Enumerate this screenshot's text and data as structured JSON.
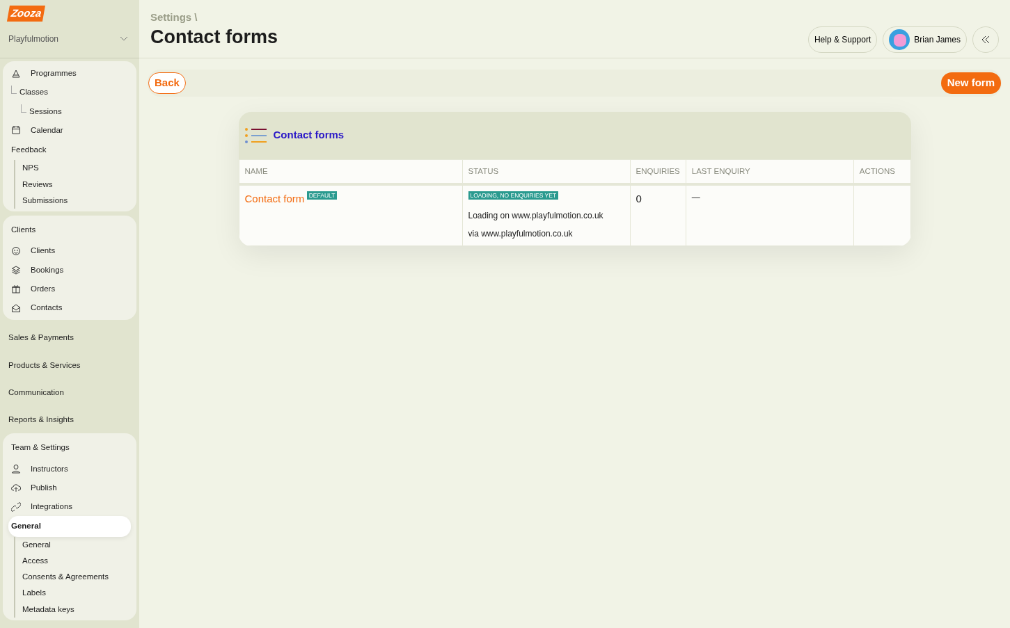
{
  "sidebar": {
    "logo": "Zooza",
    "org": "Playfulmotion",
    "sections": [
      {
        "panel": true,
        "items": [
          {
            "kind": "tree",
            "label": "Programmes",
            "selected": false,
            "children": [
              {
                "label": "Classes",
                "children": [
                  {
                    "label": "Sessions"
                  }
                ]
              }
            ]
          },
          {
            "kind": "link",
            "label": "Calendar",
            "selected": false
          },
          {
            "kind": "group",
            "label": "Feedback",
            "selected": false,
            "children": [
              {
                "label": "NPS"
              },
              {
                "label": "Reviews"
              },
              {
                "label": "Submissions"
              }
            ]
          }
        ]
      },
      {
        "panel": true,
        "title": "Clients",
        "items": [
          {
            "kind": "link",
            "label": "Clients",
            "selected": false
          },
          {
            "kind": "link",
            "label": "Bookings",
            "selected": false
          },
          {
            "kind": "link",
            "label": "Orders",
            "selected": false
          },
          {
            "kind": "link",
            "label": "Contacts",
            "selected": false
          }
        ]
      },
      {
        "panel": false,
        "items": [
          {
            "kind": "heading",
            "label": "Sales & Payments",
            "selected": false
          },
          {
            "kind": "heading",
            "label": "Products & Services",
            "selected": false
          },
          {
            "kind": "heading",
            "label": "Communication",
            "selected": false
          },
          {
            "kind": "heading",
            "label": "Reports & Insights",
            "selected": false
          }
        ]
      },
      {
        "panel": true,
        "title": "Team & Settings",
        "items": [
          {
            "kind": "link",
            "label": "Instructors",
            "selected": false
          },
          {
            "kind": "link",
            "label": "Publish",
            "selected": false
          },
          {
            "kind": "link",
            "label": "Integrations",
            "selected": false
          },
          {
            "kind": "group",
            "label": "General",
            "selected": true,
            "children": [
              {
                "label": "General"
              },
              {
                "label": "Access"
              },
              {
                "label": "Consents & Agreements"
              },
              {
                "label": "Labels"
              },
              {
                "label": "Metadata keys"
              }
            ]
          }
        ]
      }
    ]
  },
  "header": {
    "breadcrumb": "Settings \\",
    "title": "Contact forms",
    "help": "Help & Support",
    "user": "Brian James"
  },
  "toolbar": {
    "back": "Back",
    "new": "New form"
  },
  "card": {
    "title": "Contact forms",
    "columns": [
      "NAME",
      "STATUS",
      "ENQUIRIES",
      "LAST ENQUIRY",
      "ACTIONS"
    ],
    "rows": [
      {
        "name": "Contact form",
        "badge": "DEFAULT",
        "status": "LOADING, NO ENQUIRIES YET",
        "loading_on": "Loading on www.playfulmotion.co.uk",
        "via": "via www.playfulmotion.co.uk",
        "enquiries": "0",
        "last_enquiry": "—"
      }
    ]
  }
}
